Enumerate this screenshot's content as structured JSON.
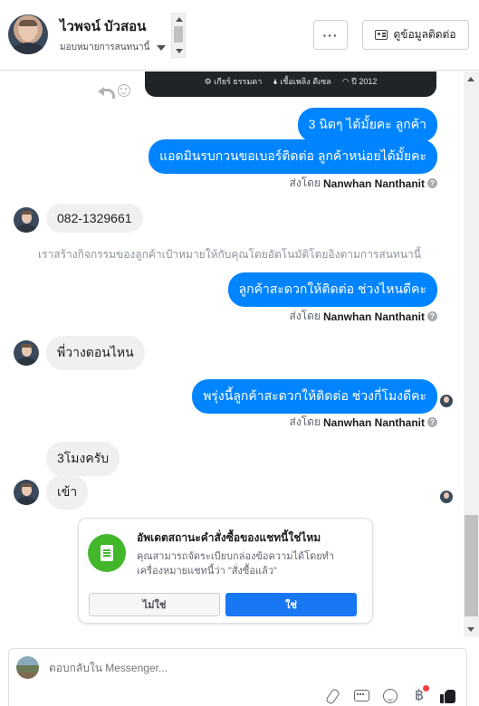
{
  "header": {
    "contact_name": "ไวพจน์ บัวสอน",
    "assign_label": "มอบหมายการสนทนานี้",
    "more_label": "···",
    "info_label": "ดูข้อมูลติดต่อ"
  },
  "image_card": {
    "items": [
      "⚙ เกียร์ ธรรมดา",
      "🌢 เชื้อเพลิง ดีเซล",
      "◠ ปี 2012"
    ]
  },
  "messages": [
    {
      "dir": "out",
      "text": "3 นิดๆ ได้มั้ยคะ ลูกค้า"
    },
    {
      "dir": "out",
      "text": "แอดมินรบกวนขอเบอร์ติดต่อ ลูกค้าหน่อยได้มั้ยคะ"
    },
    {
      "dir": "sentby",
      "prefix": "ส่งโดย",
      "name": "Nanwhan Nanthanit"
    },
    {
      "dir": "in",
      "text": "082-1329661"
    },
    {
      "dir": "system",
      "text": "เราสร้างกิจกรรมของลูกค้าเป้าหมายให้กับคุณโดยอัตโนมัติโดยอิงตามการสนทนานี้"
    },
    {
      "dir": "out",
      "text": "ลูกค้าสะดวกให้ติดต่อ ช่วงไหนดีคะ"
    },
    {
      "dir": "sentby",
      "prefix": "ส่งโดย",
      "name": "Nanwhan Nanthanit"
    },
    {
      "dir": "in",
      "text": "พี่วางตอนไหน"
    },
    {
      "dir": "out",
      "text": "พรุ่งนี้ลูกค้าสะดวกให้ติดต่อ ช่วงกี่โมงดีคะ"
    },
    {
      "dir": "sentby",
      "prefix": "ส่งโดย",
      "name": "Nanwhan Nanthanit"
    },
    {
      "dir": "in",
      "text": "3โมงครับ"
    },
    {
      "dir": "in",
      "text": "เข้า"
    }
  ],
  "order_prompt": {
    "title": "อัพเดตสถานะคำสั่งซื้อของแชทนี้ใช่ไหม",
    "description": "คุณสามารถจัดระเบียบกล่องข้อความได้โดยทำเครื่องหมายแชทนี้ว่า \"สั่งซื้อแล้ว\"",
    "no_label": "ไม่ใช่",
    "yes_label": "ใช่"
  },
  "composer": {
    "placeholder": "ตอบกลับใน Messenger...",
    "baht_symbol": "฿"
  },
  "colors": {
    "outgoing_bubble": "#0084ff",
    "incoming_bubble": "#f1f0f0",
    "primary_button": "#1877f2",
    "order_icon_bg": "#42b72a"
  }
}
